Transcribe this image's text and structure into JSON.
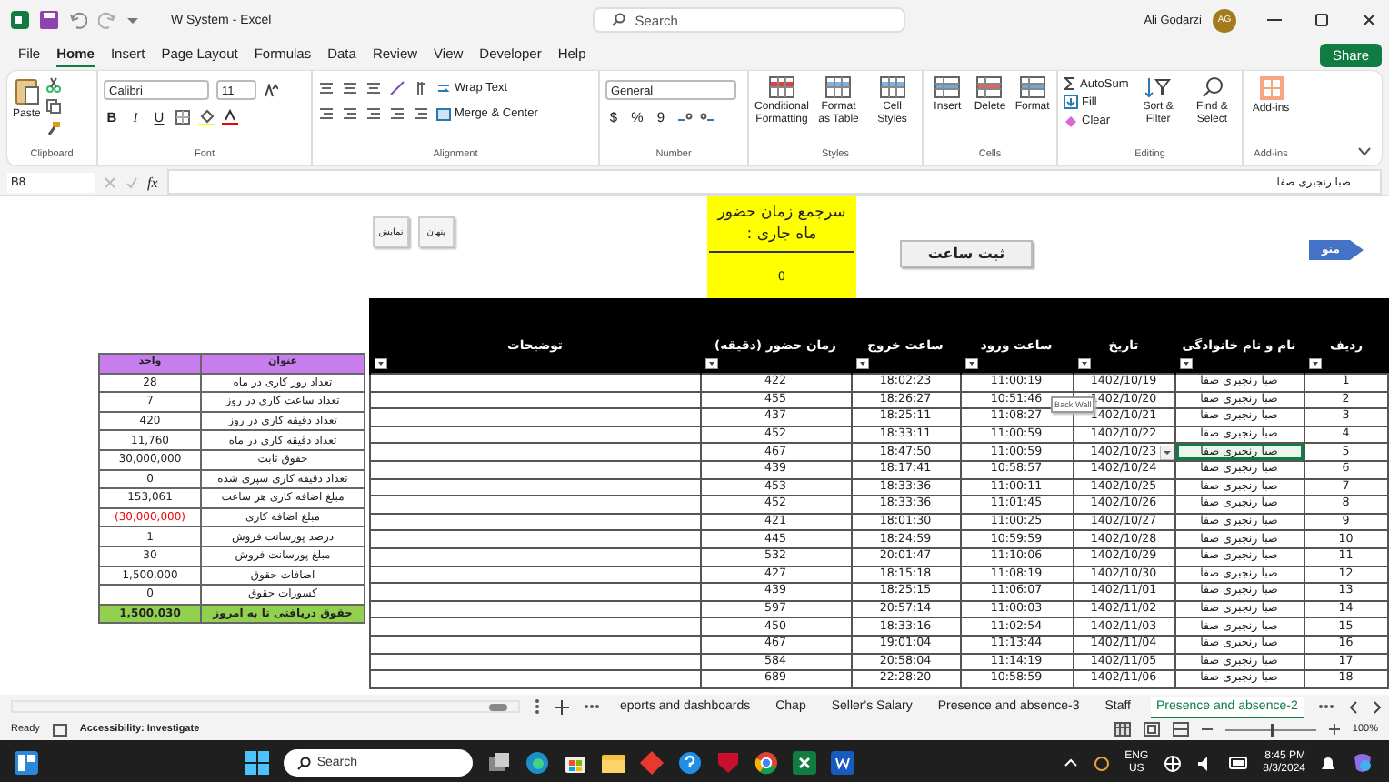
{
  "window": {
    "title": "W System  -  Excel",
    "search_placeholder": "Search",
    "user": "Ali Godarzi",
    "avatar": "AG"
  },
  "menu_tabs": [
    {
      "label": "File",
      "selected": false
    },
    {
      "label": "Home",
      "selected": true
    },
    {
      "label": "Insert",
      "selected": false
    },
    {
      "label": "Page Layout",
      "selected": false
    },
    {
      "label": "Formulas",
      "selected": false
    },
    {
      "label": "Data",
      "selected": false
    },
    {
      "label": "Review",
      "selected": false
    },
    {
      "label": "View",
      "selected": false
    },
    {
      "label": "Developer",
      "selected": false
    },
    {
      "label": "Help",
      "selected": false
    }
  ],
  "share": "Share",
  "ribbon": {
    "clipboard": {
      "label": "Clipboard",
      "paste": "Paste"
    },
    "font": {
      "label": "Font",
      "family": "Calibri",
      "size": "11",
      "styles": [
        "B",
        "I",
        "U"
      ]
    },
    "alignment": {
      "label": "Alignment",
      "wrap": "Wrap Text",
      "merge": "Merge & Center"
    },
    "number": {
      "label": "Number",
      "format": "General",
      "styles": [
        "$",
        "%",
        "9"
      ]
    },
    "styles": {
      "label": "Styles",
      "buttons": [
        "Conditional Formatting",
        "Format as Table",
        "Cell Styles"
      ]
    },
    "cells": {
      "label": "Cells",
      "buttons": [
        "Insert",
        "Delete",
        "Format"
      ]
    },
    "editing": {
      "label": "Editing",
      "small": [
        "AutoSum",
        "Fill",
        "Clear"
      ],
      "large": [
        "Sort & Filter",
        "Find & Select"
      ]
    },
    "addins": {
      "label": "Add-ins",
      "button": "Add-ins"
    }
  },
  "formula_bar": {
    "name_box": "B8",
    "fx": "fx",
    "value": "صبا رنجبری صفا"
  },
  "sheet": {
    "view_buttons": [
      "پنهان",
      "نمایش"
    ],
    "summary": {
      "title": "سرجمع زمان حضور ماه جاری :",
      "value": "0"
    },
    "record_button": "ثبت ساعت",
    "menu_button": "منو",
    "tooltip": "Back Wall",
    "summary_table": {
      "columns": [
        "عنوان",
        "واحد"
      ],
      "rows": [
        {
          "title": "تعداد روز کاری در ماه",
          "value": "28",
          "kind": "plain"
        },
        {
          "title": "تعداد ساعت کاری در روز",
          "value": "7",
          "kind": "plain"
        },
        {
          "title": "تعداد دقیقه کاری در روز",
          "value": "420",
          "kind": "plain"
        },
        {
          "title": "تعداد دقیقه کاری در ماه",
          "value": "11,760",
          "kind": "plain"
        },
        {
          "title": "حقوق ثابت",
          "value": "30,000,000",
          "kind": "plain"
        },
        {
          "title": "تعداد دقیقه کاری سپری شده",
          "value": "0",
          "kind": "plain"
        },
        {
          "title": "مبلغ اضافه کاری هر ساعت",
          "value": "153,061",
          "kind": "plain"
        },
        {
          "title": "مبلغ اضافه کاری",
          "value": "(30,000,000)",
          "kind": "negative"
        },
        {
          "title": "درصد پورسانت فروش",
          "value": "1",
          "kind": "plain"
        },
        {
          "title": "مبلغ پورسانت فروش",
          "value": "30",
          "kind": "plain"
        },
        {
          "title": "اضافات حقوق",
          "value": "1,500,000",
          "kind": "plain"
        },
        {
          "title": "کسورات حقوق",
          "value": "0",
          "kind": "plain"
        },
        {
          "title": "حقوق دریافتی تا به امروز",
          "value": "1,500,030",
          "kind": "total"
        }
      ]
    },
    "table": {
      "columns": [
        "ردیف",
        "نام و نام خانوادگی",
        "تاریخ",
        "ساعت ورود",
        "ساعت خروج",
        "زمان حضور (دقیقه)",
        "توضیحات"
      ],
      "rows": [
        {
          "minutes": "422",
          "exit": "18:02:23",
          "entry": "11:00:19",
          "date": "1402/10/19",
          "name": "صبا رنجبری صفا",
          "no": "1",
          "selected": false
        },
        {
          "minutes": "455",
          "exit": "18:26:27",
          "entry": "10:51:46",
          "date": "1402/10/20",
          "name": "صبا رنجبری صفا",
          "no": "2",
          "selected": false
        },
        {
          "minutes": "437",
          "exit": "18:25:11",
          "entry": "11:08:27",
          "date": "1402/10/21",
          "name": "صبا رنجبری صفا",
          "no": "3",
          "selected": false
        },
        {
          "minutes": "452",
          "exit": "18:33:11",
          "entry": "11:00:59",
          "date": "1402/10/22",
          "name": "صبا رنجبری صفا",
          "no": "4",
          "selected": false
        },
        {
          "minutes": "467",
          "exit": "18:47:50",
          "entry": "11:00:59",
          "date": "1402/10/23",
          "name": "صبا رنجبری صفا",
          "no": "5",
          "selected": true
        },
        {
          "minutes": "439",
          "exit": "18:17:41",
          "entry": "10:58:57",
          "date": "1402/10/24",
          "name": "صبا رنجبری صفا",
          "no": "6",
          "selected": false
        },
        {
          "minutes": "453",
          "exit": "18:33:36",
          "entry": "11:00:11",
          "date": "1402/10/25",
          "name": "صبا رنجبری صفا",
          "no": "7",
          "selected": false
        },
        {
          "minutes": "452",
          "exit": "18:33:36",
          "entry": "11:01:45",
          "date": "1402/10/26",
          "name": "صبا رنجبری صفا",
          "no": "8",
          "selected": false
        },
        {
          "minutes": "421",
          "exit": "18:01:30",
          "entry": "11:00:25",
          "date": "1402/10/27",
          "name": "صبا رنجبری صفا",
          "no": "9",
          "selected": false
        },
        {
          "minutes": "445",
          "exit": "18:24:59",
          "entry": "10:59:59",
          "date": "1402/10/28",
          "name": "صبا رنجبری صفا",
          "no": "10",
          "selected": false
        },
        {
          "minutes": "532",
          "exit": "20:01:47",
          "entry": "11:10:06",
          "date": "1402/10/29",
          "name": "صبا رنجبری صفا",
          "no": "11",
          "selected": false
        },
        {
          "minutes": "427",
          "exit": "18:15:18",
          "entry": "11:08:19",
          "date": "1402/10/30",
          "name": "صبا رنجبری صفا",
          "no": "12",
          "selected": false
        },
        {
          "minutes": "439",
          "exit": "18:25:15",
          "entry": "11:06:07",
          "date": "1402/11/01",
          "name": "صبا رنجبری صفا",
          "no": "13",
          "selected": false
        },
        {
          "minutes": "597",
          "exit": "20:57:14",
          "entry": "11:00:03",
          "date": "1402/11/02",
          "name": "صبا رنجبری صفا",
          "no": "14",
          "selected": false
        },
        {
          "minutes": "450",
          "exit": "18:33:16",
          "entry": "11:02:54",
          "date": "1402/11/03",
          "name": "صبا رنجبری صفا",
          "no": "15",
          "selected": false
        },
        {
          "minutes": "467",
          "exit": "19:01:04",
          "entry": "11:13:44",
          "date": "1402/11/04",
          "name": "صبا رنجبری صفا",
          "no": "16",
          "selected": false
        },
        {
          "minutes": "584",
          "exit": "20:58:04",
          "entry": "11:14:19",
          "date": "1402/11/05",
          "name": "صبا رنجبری صفا",
          "no": "17",
          "selected": false
        },
        {
          "minutes": "689",
          "exit": "22:28:20",
          "entry": "10:58:59",
          "date": "1402/11/06",
          "name": "صبا رنجبری صفا",
          "no": "18",
          "selected": false
        }
      ]
    }
  },
  "sheet_tabs": [
    {
      "label": "eports and dashboards",
      "selected": false
    },
    {
      "label": "Chap",
      "selected": false
    },
    {
      "label": "Seller's Salary",
      "selected": false
    },
    {
      "label": "Presence and absence-3",
      "selected": false
    },
    {
      "label": "Staff",
      "selected": false
    },
    {
      "label": "Presence and absence-2",
      "selected": true
    }
  ],
  "status_bar": {
    "ready": "Ready",
    "accessibility": "Accessibility: Investigate",
    "zoom": {
      "level": 0.5,
      "reading": "100%"
    }
  },
  "taskbar": {
    "search_placeholder": "Search",
    "language": "ENG",
    "region": "US",
    "time": "8:45 PM",
    "date": "8/3/2024"
  }
}
